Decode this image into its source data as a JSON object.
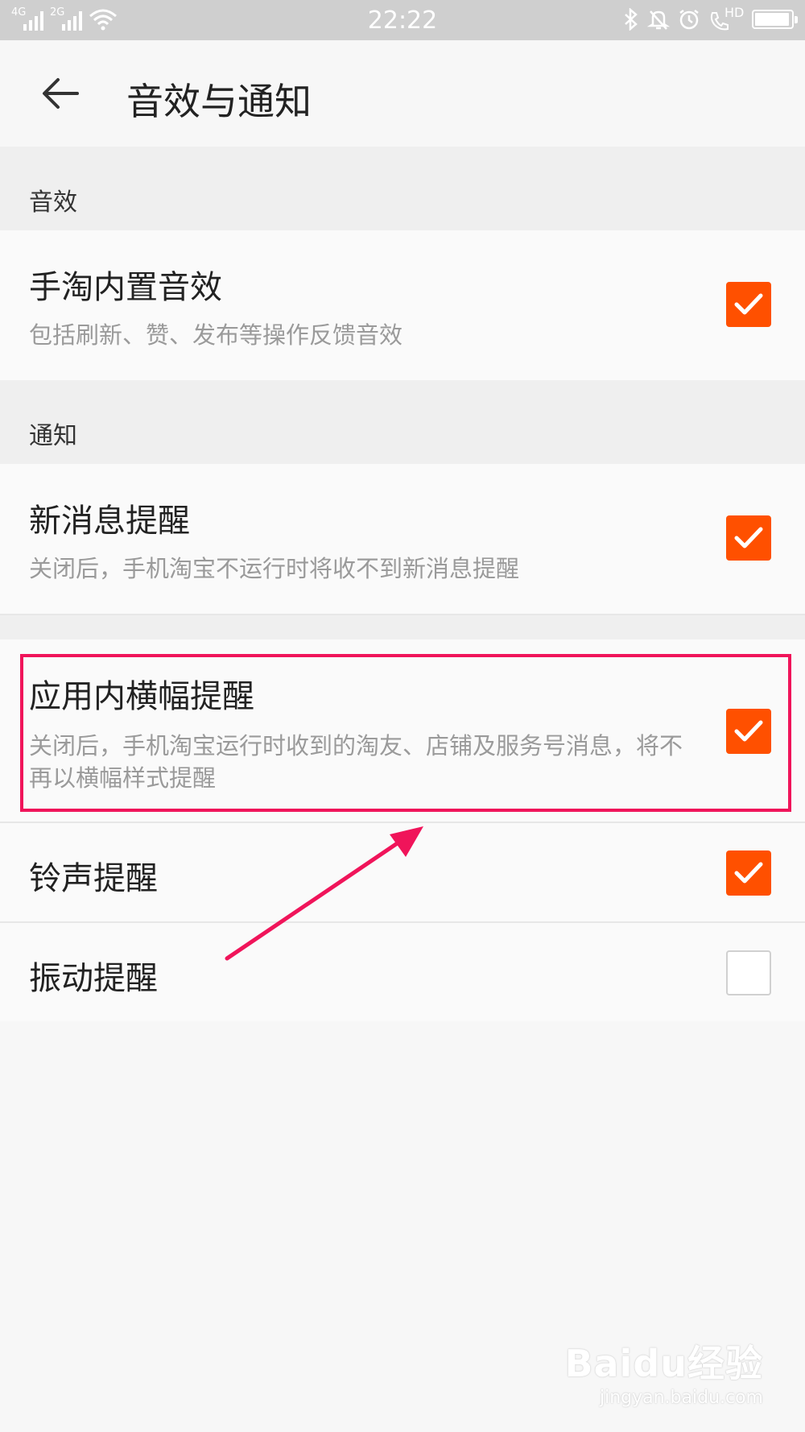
{
  "status_bar": {
    "time": "22:22",
    "network_1": "4G",
    "network_2": "2G",
    "hd_label": "HD",
    "battery_level": 0.95
  },
  "title_bar": {
    "title": "音效与通知"
  },
  "sections": {
    "sound": {
      "header": "音效",
      "items": [
        {
          "title": "手淘内置音效",
          "subtitle": "包括刷新、赞、发布等操作反馈音效",
          "checked": true
        }
      ]
    },
    "notification": {
      "header": "通知",
      "items": [
        {
          "title": "新消息提醒",
          "subtitle": "关闭后，手机淘宝不运行时将收不到新消息提醒",
          "checked": true
        },
        {
          "title": "应用内横幅提醒",
          "subtitle": "关闭后，手机淘宝运行时收到的淘友、店铺及服务号消息，将不再以横幅样式提醒",
          "checked": true
        },
        {
          "title": "铃声提醒",
          "checked": true
        },
        {
          "title": "振动提醒",
          "checked": false
        }
      ]
    }
  },
  "annotation": {
    "highlight_color": "#f0145a"
  },
  "colors": {
    "accent": "#ff5000",
    "background": "#f7f7f7"
  },
  "watermark": {
    "logo": "Baidu经验",
    "url": "jingyan.baidu.com"
  }
}
